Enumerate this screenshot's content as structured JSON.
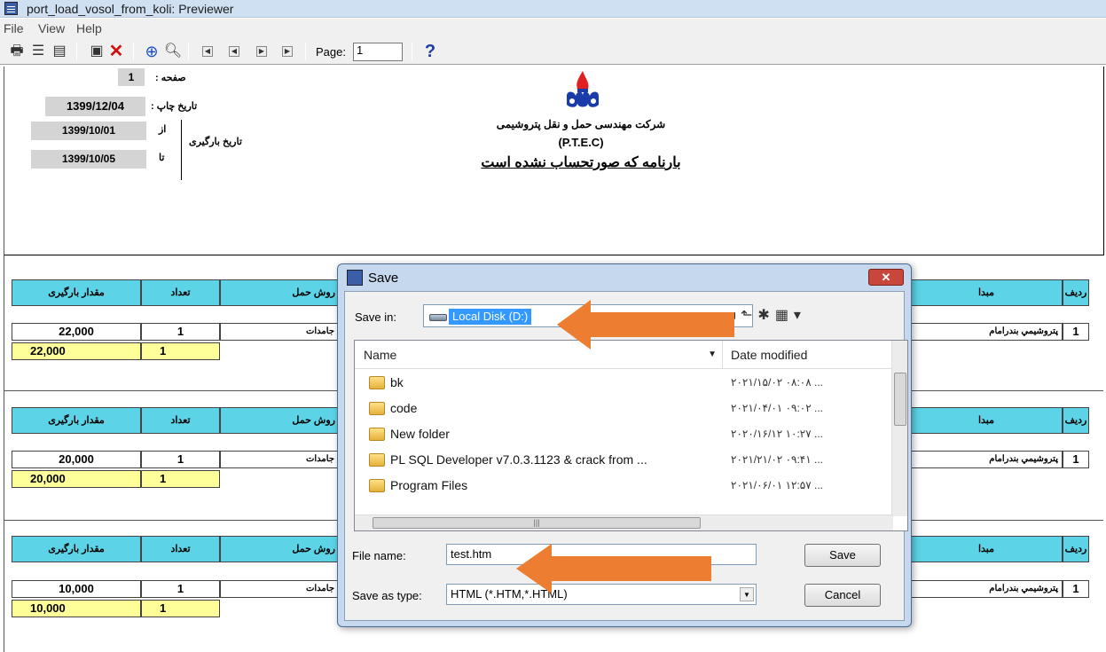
{
  "window": {
    "title": "port_load_vosol_from_koli: Previewer"
  },
  "menu": [
    "File",
    "View",
    "Help"
  ],
  "toolbar": {
    "page_label": "Page:",
    "page_value": "1",
    "icons": [
      "print-icon",
      "print-setup-icon",
      "save-icon",
      "view-icon",
      "close-icon",
      "zoom-in-icon",
      "zoom-out-icon",
      "first-page-icon",
      "prev-page-icon",
      "next-page-icon",
      "last-page-icon",
      "help-icon"
    ]
  },
  "report": {
    "page_number": "1",
    "page_label": "صفحه :",
    "print_date_label": "تاریخ چاپ :",
    "print_date": "1399/12/04",
    "load_date_label": "تاریخ بارگیری",
    "from_label": "از",
    "from_date": "1399/10/01",
    "to_label": "تا",
    "to_date": "1399/10/05",
    "company_name": "شرکت مهندسی حمل و نقل پتروشیمی",
    "company_abbr": "(P.T.E.C)",
    "report_title": "بارنامه که صورتحساب نشده است",
    "columns": {
      "load_amount": "مقدار بارگیری",
      "count": "تعداد",
      "transport_method": "روش حمل",
      "origin": "مبدا",
      "row": "ردیف"
    },
    "groups": [
      {
        "amount": "22,000",
        "count": "1",
        "method": "جامدات",
        "origin": "پتروشیمي بندرامام",
        "row": "1",
        "total_amount": "22,000",
        "total_count": "1"
      },
      {
        "amount": "20,000",
        "count": "1",
        "method": "جامدات",
        "origin": "پتروشیمي بندرامام",
        "row": "1",
        "total_amount": "20,000",
        "total_count": "1"
      },
      {
        "amount": "10,000",
        "count": "1",
        "method": "جامدات",
        "origin": "پتروشیمي بندرامام",
        "row": "1",
        "total_amount": "10,000",
        "total_count": "1"
      }
    ]
  },
  "dialog": {
    "title": "Save",
    "close_label": "✕",
    "save_in_label": "Save in:",
    "save_in_value": "Local Disk (D:)",
    "col_name": "Name",
    "col_date": "Date modified",
    "files": [
      {
        "name": "bk",
        "date": "۲۰۲۱/۱۵/۰۲ ۰۸:۰۸ ..."
      },
      {
        "name": "code",
        "date": "۲۰۲۱/۰۴/۰۱ ۰۹:۰۲ ..."
      },
      {
        "name": "New folder",
        "date": "۲۰۲۰/۱۶/۱۲ ۱۰:۲۷ ..."
      },
      {
        "name": "PL SQL Developer v7.0.3.1123 & crack from ...",
        "date": "۲۰۲۱/۲۱/۰۲ ۰۹:۴۱ ..."
      },
      {
        "name": "Program Files",
        "date": "۲۰۲۱/۰۶/۰۱ ۱۲:۵۷ ..."
      }
    ],
    "file_name_label": "File name:",
    "file_name_value": "test.htm",
    "save_type_label": "Save as type:",
    "save_type_value": "HTML (*.HTM,*.HTML)",
    "save_button": "Save",
    "cancel_button": "Cancel"
  },
  "colors": {
    "header_cyan": "#5cd3e6",
    "total_yellow": "#ffff99",
    "arrow_orange": "#ed7d31"
  }
}
